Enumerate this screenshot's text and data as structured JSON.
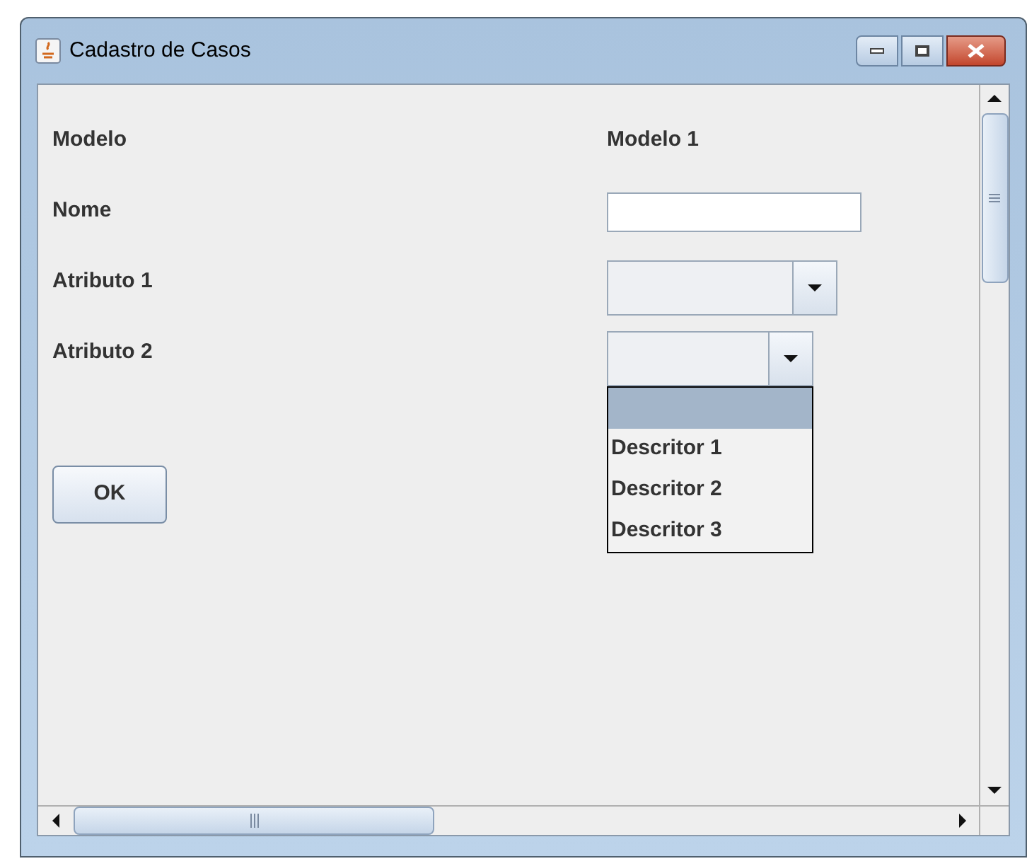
{
  "window": {
    "title": "Cadastro de Casos"
  },
  "form": {
    "rows": [
      {
        "kind": "text",
        "label": "Modelo",
        "value": "Modelo 1"
      },
      {
        "kind": "input",
        "label": "Nome"
      },
      {
        "kind": "combo",
        "label": "Atributo 1",
        "expanded": false
      },
      {
        "kind": "combo",
        "label": "Atributo 2",
        "expanded": true
      }
    ]
  },
  "dropdown": {
    "items": [
      {
        "selected": true
      },
      {
        "label": "Descritor 1",
        "selected": false
      },
      {
        "label": "Descritor 2",
        "selected": false
      },
      {
        "label": "Descritor 3",
        "selected": false
      }
    ]
  },
  "buttons": [
    "OK"
  ]
}
